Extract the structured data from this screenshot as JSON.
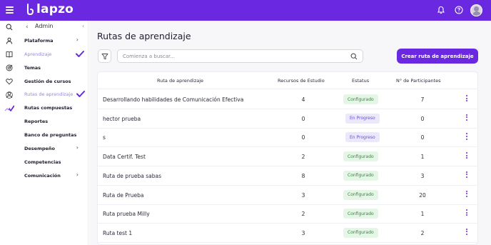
{
  "app": {
    "brand": "lapzo",
    "accent_color": "#6a29e0"
  },
  "topbar": {
    "icons": [
      "menu-icon",
      "bell-icon",
      "help-icon",
      "avatar"
    ]
  },
  "rail": {
    "icons": [
      "search-icon",
      "user-icon",
      "book-icon",
      "target-icon",
      "heart-icon",
      "users-icon",
      "chart-check-icon"
    ]
  },
  "sidebar": {
    "title": "Admin",
    "items": [
      {
        "label": "Plataforma",
        "has_chevron": true,
        "active": false
      },
      {
        "label": "Aprendizaje",
        "has_chevron": false,
        "active": true
      },
      {
        "label": "Temas",
        "has_chevron": false,
        "active": false
      },
      {
        "label": "Gestión de cursos",
        "has_chevron": false,
        "active": false
      },
      {
        "label": "Rutas de aprendizaje",
        "has_chevron": false,
        "active": true
      },
      {
        "label": "Rutas compuestas",
        "has_chevron": false,
        "active": false
      },
      {
        "label": "Reportes",
        "has_chevron": false,
        "active": false
      },
      {
        "label": "Banco de preguntas",
        "has_chevron": false,
        "active": false
      },
      {
        "label": "Desempeño",
        "has_chevron": true,
        "active": false
      },
      {
        "label": "Competencias",
        "has_chevron": false,
        "active": false
      },
      {
        "label": "Comunicación",
        "has_chevron": true,
        "active": false
      }
    ]
  },
  "main": {
    "title": "Rutas de aprendizaje",
    "search_placeholder": "Comienza a buscar...",
    "create_button": "Crear ruta de aprendizaje",
    "table": {
      "headers": [
        "Ruta de aprendizaje",
        "Recursos de Estudio",
        "Estatus",
        "N° de Participantes"
      ],
      "rows": [
        {
          "name": "Desarrollando habilidades de Comunicación Efectiva",
          "resources": "4",
          "status": "Configurado",
          "status_kind": "ok",
          "participants": "7"
        },
        {
          "name": "hector prueba",
          "resources": "0",
          "status": "En Progreso",
          "status_kind": "prog",
          "participants": "0"
        },
        {
          "name": "s",
          "resources": "0",
          "status": "En Progreso",
          "status_kind": "prog",
          "participants": "0"
        },
        {
          "name": "Data Certif. Test",
          "resources": "2",
          "status": "Configurado",
          "status_kind": "ok",
          "participants": "1"
        },
        {
          "name": "Ruta de prueba sabas",
          "resources": "8",
          "status": "Configurado",
          "status_kind": "ok",
          "participants": "3"
        },
        {
          "name": "Ruta de Prueba",
          "resources": "3",
          "status": "Configurado",
          "status_kind": "ok",
          "participants": "20"
        },
        {
          "name": "Ruta prueba Milly",
          "resources": "2",
          "status": "Configurado",
          "status_kind": "ok",
          "participants": "1"
        },
        {
          "name": "Ruta test 1",
          "resources": "3",
          "status": "Configurado",
          "status_kind": "ok",
          "participants": "2"
        }
      ]
    }
  }
}
